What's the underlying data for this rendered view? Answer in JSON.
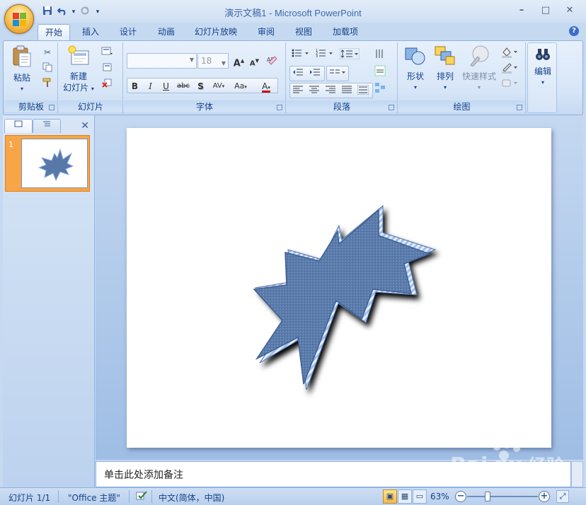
{
  "window": {
    "title": "演示文稿1 - Microsoft PowerPoint",
    "controls": {
      "minimize": "–",
      "maximize": "□",
      "close": "✕"
    }
  },
  "qat": {
    "save_icon": "💾",
    "undo_icon": "↶",
    "undo_menu": "▾",
    "redo_icon": "↻",
    "customize": "▾"
  },
  "tabs": [
    {
      "label": "开始",
      "active": true
    },
    {
      "label": "插入"
    },
    {
      "label": "设计"
    },
    {
      "label": "动画"
    },
    {
      "label": "幻灯片放映"
    },
    {
      "label": "审阅"
    },
    {
      "label": "视图"
    },
    {
      "label": "加载项"
    }
  ],
  "help": "?",
  "ribbon": {
    "clipboard": {
      "label": "剪贴板",
      "paste": "粘贴"
    },
    "slides": {
      "label": "幻灯片",
      "new_slide_line1": "新建",
      "new_slide_line2": "幻灯片"
    },
    "font": {
      "label": "字体",
      "font_name": "",
      "font_size": "18",
      "grow": "A",
      "shrink": "A",
      "bold": "B",
      "italic": "I",
      "underline": "U",
      "strike": "abc",
      "shadow": "S",
      "spacing": "AV",
      "case": "Aa",
      "color": "A"
    },
    "paragraph": {
      "label": "段落"
    },
    "drawing": {
      "label": "绘图",
      "shapes": "形状",
      "arrange": "排列",
      "quick_styles": "快速样式"
    },
    "editing": {
      "label": "编辑"
    }
  },
  "slides_pane": {
    "close": "✕",
    "slide_number": "1"
  },
  "notes": {
    "placeholder": "单击此处添加备注"
  },
  "status": {
    "slide_info": "幻灯片 1/1",
    "theme": "\"Office 主题\"",
    "language": "中文(简体，中国)",
    "zoom": "63%",
    "zoom_out": "−",
    "zoom_in": "+",
    "zoom_level": 0.63
  },
  "watermark": {
    "text": "Baidu经验",
    "sub": "jingyan.baidu.com"
  },
  "colors": {
    "shape_fill": "#5878a8",
    "shape_bevel": "#8fb0df",
    "accent_orange": "#f7a547",
    "ribbon_text": "#15428b"
  }
}
